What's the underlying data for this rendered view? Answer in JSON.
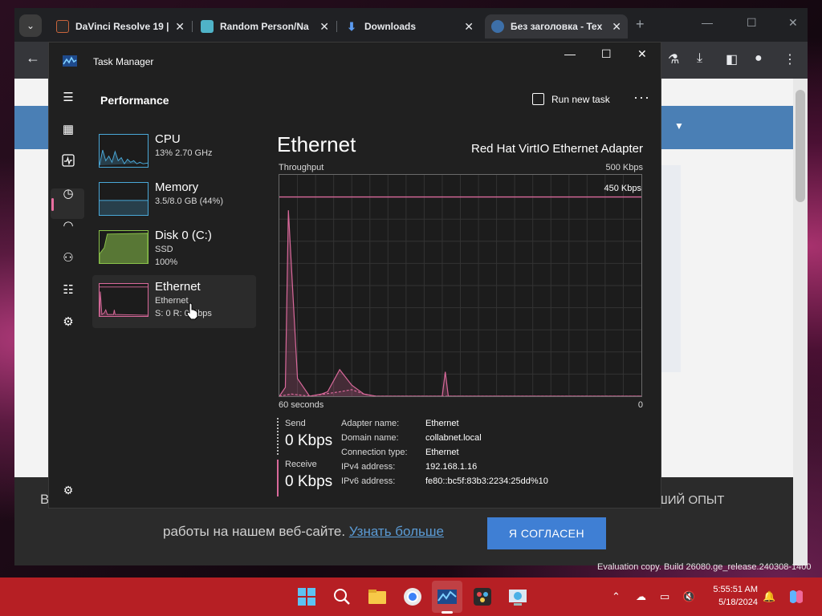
{
  "browser": {
    "tabs": [
      {
        "label": "DaVinci Resolve 19 |"
      },
      {
        "label": "Random Person/Na"
      },
      {
        "label": "Downloads"
      },
      {
        "label": "Без заголовка - Tex"
      }
    ],
    "tab_close": "✕",
    "new_tab": "+",
    "page": {
      "cookie_left": "В",
      "cookie_right": "ШИЙ ОПЫТ",
      "cookie_text": "работы на нашем веб-сайте.",
      "cookie_link": "Узнать больше",
      "cookie_button": "Я СОГЛАСЕН"
    }
  },
  "task_manager": {
    "title": "Task Manager",
    "section": "Performance",
    "run_new_task": "Run new task",
    "more": "···",
    "nav": [
      "hamburger-icon",
      "processes-icon",
      "performance-icon",
      "app-history-icon",
      "startup-apps-icon",
      "users-icon",
      "details-icon",
      "services-icon",
      "settings-icon"
    ],
    "list": [
      {
        "name": "CPU",
        "sub1": "13%  2.70 GHz",
        "sub2": "",
        "color": "#4aa8d8"
      },
      {
        "name": "Memory",
        "sub1": "3.5/8.0 GB (44%)",
        "sub2": "",
        "color": "#4aa8d8"
      },
      {
        "name": "Disk 0 (C:)",
        "sub1": "SSD",
        "sub2": "100%",
        "color": "#8bc34a"
      },
      {
        "name": "Ethernet",
        "sub1": "Ethernet",
        "sub2": "S: 0 R: 0 Kbps",
        "color": "#d9699b"
      }
    ],
    "detail": {
      "title": "Ethernet",
      "adapter": "Red Hat VirtIO Ethernet Adapter",
      "throughput_label": "Throughput",
      "max_label": "500 Kbps",
      "line_label": "450 Kbps",
      "x_left": "60 seconds",
      "x_right": "0",
      "send_label": "Send",
      "send_value": "0 Kbps",
      "receive_label": "Receive",
      "receive_value": "0 Kbps",
      "properties": [
        {
          "key": "Adapter name:",
          "value": "Ethernet"
        },
        {
          "key": "Domain name:",
          "value": "collabnet.local"
        },
        {
          "key": "Connection type:",
          "value": "Ethernet"
        },
        {
          "key": "IPv4 address:",
          "value": "192.168.1.16"
        },
        {
          "key": "IPv6 address:",
          "value": "fe80::bc5f:83b3:2234:25dd%10"
        }
      ]
    }
  },
  "chart_data": {
    "type": "area",
    "title": "Throughput",
    "xlabel": "",
    "ylabel": "",
    "x_range_seconds": [
      60,
      0
    ],
    "ylim": [
      0,
      500
    ],
    "reference_line": 450,
    "series": [
      {
        "name": "Send",
        "color": "#d9699b",
        "x": [
          60,
          59,
          58.5,
          57,
          55,
          53,
          52,
          50,
          48,
          46,
          44,
          43,
          42,
          40,
          35,
          33,
          32.5,
          32,
          31,
          25,
          20,
          10,
          0
        ],
        "values": [
          0,
          20,
          420,
          40,
          0,
          5,
          10,
          60,
          25,
          5,
          0,
          0,
          0,
          0,
          0,
          0,
          55,
          0,
          0,
          0,
          0,
          0,
          0
        ]
      },
      {
        "name": "Receive",
        "color": "#d9699b",
        "x": [
          60,
          58,
          55,
          50,
          48,
          46,
          44,
          40,
          35,
          33,
          32,
          30,
          20,
          10,
          0
        ],
        "values": [
          0,
          5,
          0,
          10,
          15,
          5,
          0,
          0,
          0,
          0,
          0,
          0,
          0,
          0,
          0
        ]
      }
    ]
  },
  "taskbar": {
    "time": "5:55:51 AM",
    "date": "5/18/2024",
    "watermark": "Evaluation copy. Build 26080.ge_release.240308-1400"
  }
}
